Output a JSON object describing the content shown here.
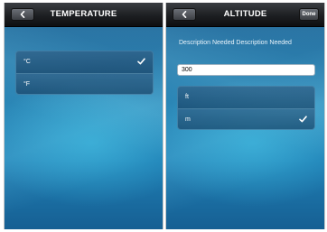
{
  "temperature_screen": {
    "title": "TEMPERATURE",
    "back_icon": "chevron-left-icon",
    "options": [
      {
        "label": "°C",
        "selected": true
      },
      {
        "label": "°F",
        "selected": false
      }
    ]
  },
  "altitude_screen": {
    "title": "ALTITUDE",
    "back_icon": "chevron-left-icon",
    "done_label": "Done",
    "description": "Description Needed Description Needed",
    "input_value": "300",
    "options": [
      {
        "label": "ft",
        "selected": false
      },
      {
        "label": "m",
        "selected": true
      }
    ]
  },
  "colors": {
    "navbar": "#1d1f22",
    "background": "#2a86b6",
    "text": "#ffffff"
  }
}
